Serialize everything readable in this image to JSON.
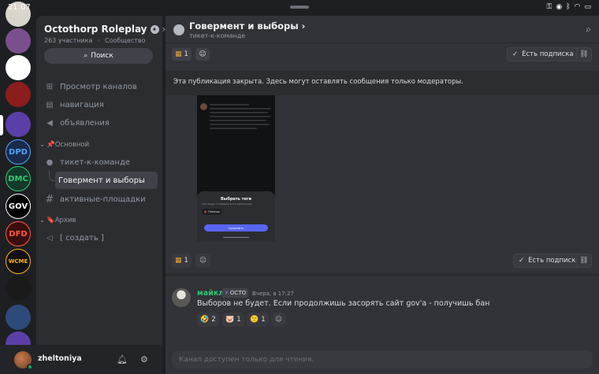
{
  "status_bar": {
    "time": "21:07",
    "icons": [
      "key-icon",
      "eye-icon",
      "bluetooth-icon",
      "wifi-icon",
      "battery-icon"
    ]
  },
  "server_rail": {
    "servers": [
      {
        "label": "",
        "bg": "#d9d4cc",
        "fg": "#222222"
      },
      {
        "label": "",
        "bg": "#7a4f8e",
        "fg": "#ffffff"
      },
      {
        "label": "",
        "bg": "#ffffff",
        "fg": "#000000"
      },
      {
        "label": "",
        "bg": "#8b1d1d",
        "fg": "#ffffff"
      },
      {
        "label": "",
        "bg": "#5b3fa8",
        "fg": "#ffd34d"
      },
      {
        "label": "DPD",
        "bg": "#1b2a4a",
        "fg": "#4fa3ff"
      },
      {
        "label": "DMC",
        "bg": "#123a2a",
        "fg": "#2ecc71"
      },
      {
        "label": "GOV",
        "bg": "#000000",
        "fg": "#ffffff"
      },
      {
        "label": "DFD",
        "bg": "#3a0e0e",
        "fg": "#ff5a3c"
      },
      {
        "label": "WCME",
        "bg": "#111111",
        "fg": "#ffb020"
      },
      {
        "label": "",
        "bg": "#1a1a1a",
        "fg": "#ffffff"
      },
      {
        "label": "",
        "bg": "#2d4a7a",
        "fg": "#ffffff"
      },
      {
        "label": "",
        "bg": "#5b3fa8",
        "fg": "#ffffff"
      }
    ]
  },
  "sidebar": {
    "server_name": "Octothorp Roleplay",
    "member_count": "263 участника",
    "community": "Сообщество",
    "search_label": "Поиск",
    "items": [
      {
        "label": "Просмотр каналов",
        "icon": "browse-icon",
        "glyph": "⊞"
      },
      {
        "label": "навигация",
        "icon": "forum-list-icon",
        "glyph": "▤"
      },
      {
        "label": "объявления",
        "icon": "megaphone-icon",
        "glyph": "📢"
      }
    ],
    "category_main": "📌Основной",
    "category_main_channels": [
      {
        "label": "тикет-к-команде",
        "icon": "forum-icon",
        "glyph": "💬"
      },
      {
        "label": "Говермент и выборы",
        "icon": "thread-icon",
        "glyph": ""
      },
      {
        "label": "активные-площадки",
        "icon": "hash-icon",
        "glyph": "#"
      }
    ],
    "category_archive": "🔖Архив",
    "category_archive_channels": [
      {
        "label": "[ создать ]",
        "icon": "speaker-icon",
        "glyph": "🔊"
      }
    ]
  },
  "user_panel": {
    "username": "zheltoniya"
  },
  "header": {
    "title": "Говермент и выборы",
    "parent": "тикет-к-команде"
  },
  "post_top": {
    "tag_count": "1",
    "follow_label": "Есть подписка"
  },
  "notice": {
    "text": "Эта публикация закрыта. Здесь могут оставлять сообщения только модераторы."
  },
  "attachment": {
    "sheet_title": "Выбрать теги",
    "sheet_sub": "Теги будут отображаться в публикации",
    "chip": "Помощь",
    "button": "Сохранить"
  },
  "post_bottom": {
    "reaction_count": "1",
    "follow_label": "Есть подписка"
  },
  "message": {
    "author": "майкл",
    "tag": "OCTO",
    "time": "Вчера, в 17:27",
    "text": "Выборов не будет. Если продолжишь засорять сайт gov'a - получишь бан",
    "author_color": "#2dc770",
    "reactions": [
      {
        "emoji": "🤣",
        "count": "2"
      },
      {
        "emoji": "🐷",
        "count": "1"
      },
      {
        "emoji": "🙁",
        "count": "1"
      }
    ]
  },
  "composer": {
    "placeholder": "Канал доступен только для чтения."
  }
}
